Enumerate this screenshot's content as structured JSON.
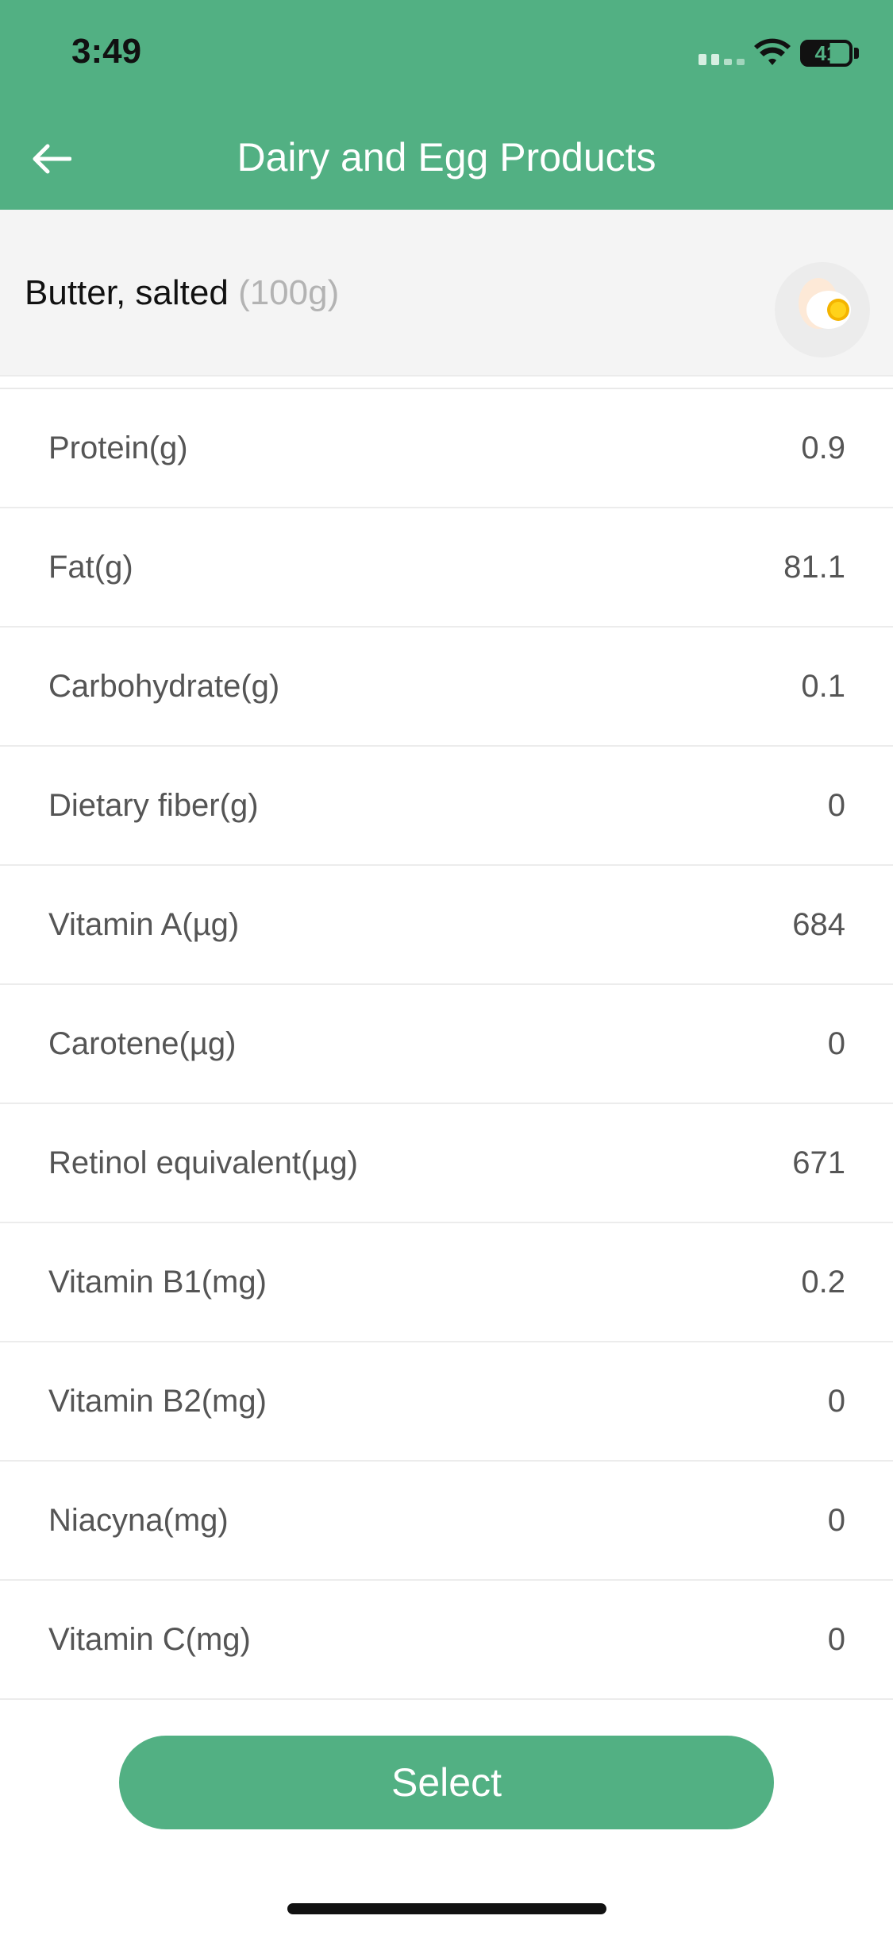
{
  "status_bar": {
    "time": "3:49",
    "battery": "41"
  },
  "header": {
    "title": "Dairy and Egg Products",
    "back_icon": "arrow-left-icon"
  },
  "food": {
    "name": "Butter, salted",
    "portion": "(100g)",
    "avatar_icon": "egg-icon"
  },
  "nutrients": [
    {
      "label": "Protein(g)",
      "value": "0.9"
    },
    {
      "label": "Fat(g)",
      "value": "81.1"
    },
    {
      "label": "Carbohydrate(g)",
      "value": "0.1"
    },
    {
      "label": "Dietary fiber(g)",
      "value": "0"
    },
    {
      "label": "Vitamin A(µg)",
      "value": "684"
    },
    {
      "label": "Carotene(µg)",
      "value": "0"
    },
    {
      "label": "Retinol equivalent(µg)",
      "value": "671"
    },
    {
      "label": "Vitamin B1(mg)",
      "value": "0.2"
    },
    {
      "label": "Vitamin B2(mg)",
      "value": "0"
    },
    {
      "label": "Niacyna(mg)",
      "value": "0"
    },
    {
      "label": "Vitamin C(mg)",
      "value": "0"
    }
  ],
  "actions": {
    "select_label": "Select"
  },
  "colors": {
    "accent": "#52b083",
    "food_bar_bg": "#f4f4f4",
    "text_muted": "#b3b3b3"
  }
}
